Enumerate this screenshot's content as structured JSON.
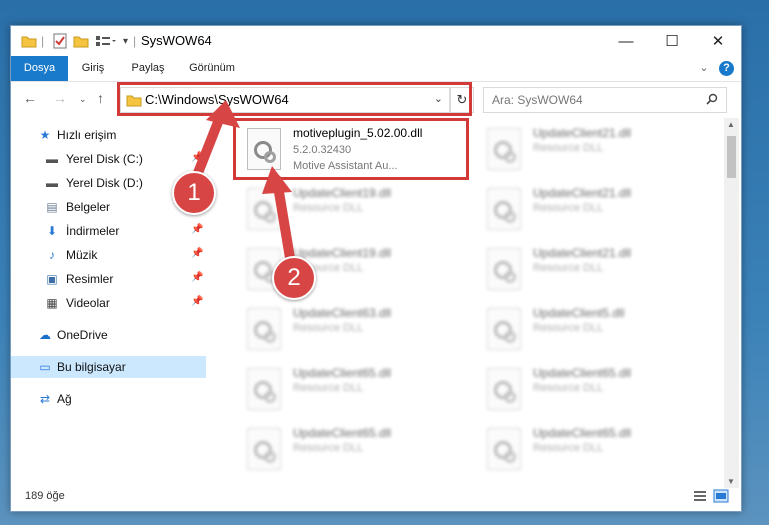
{
  "window": {
    "title": "SysWOW64",
    "controls": {
      "minimize": "—",
      "maximize": "☐",
      "close": "✕"
    }
  },
  "ribbon": {
    "tabs": [
      {
        "label": "Dosya",
        "active": true
      },
      {
        "label": "Giriş"
      },
      {
        "label": "Paylaş"
      },
      {
        "label": "Görünüm"
      }
    ],
    "help_label": "?"
  },
  "address": {
    "path": "C:\\Windows\\SysWOW64",
    "search_placeholder": "Ara: SysWOW64"
  },
  "sidebar": {
    "items": [
      {
        "label": "Hızlı erişim",
        "icon": "star-icon",
        "glyph": "★"
      },
      {
        "label": "Yerel Disk (C:)",
        "icon": "drive-icon",
        "glyph": "▬",
        "pinned": true
      },
      {
        "label": "Yerel Disk (D:)",
        "icon": "drive-icon",
        "glyph": "▬",
        "pinned": true
      },
      {
        "label": "Belgeler",
        "icon": "documents-icon",
        "glyph": "▤",
        "pinned": true
      },
      {
        "label": "İndirmeler",
        "icon": "download-icon",
        "glyph": "⬇",
        "pinned": true
      },
      {
        "label": "Müzik",
        "icon": "music-icon",
        "glyph": "♪",
        "pinned": true
      },
      {
        "label": "Resimler",
        "icon": "pictures-icon",
        "glyph": "▣",
        "pinned": true
      },
      {
        "label": "Videolar",
        "icon": "video-icon",
        "glyph": "▦",
        "pinned": true
      },
      {
        "label": "OneDrive",
        "icon": "cloud-icon",
        "glyph": "☁"
      },
      {
        "label": "Bu bilgisayar",
        "icon": "computer-icon",
        "glyph": "▭",
        "selected": true
      },
      {
        "label": "Ağ",
        "icon": "network-icon",
        "glyph": "⇄"
      }
    ]
  },
  "files": {
    "highlighted": {
      "name": "motiveplugin_5.02.00.dll",
      "version": "5.2.0.32430",
      "description": "Motive Assistant Au..."
    },
    "left_column": [
      {
        "name": "UpdateClient19.dll",
        "type": "Resource DLL"
      },
      {
        "name": "UpdateClient19.dll",
        "type": "Resource DLL"
      },
      {
        "name": "UpdateClient63.dll",
        "type": "Resource DLL"
      },
      {
        "name": "UpdateClient65.dll",
        "type": "Resource DLL"
      },
      {
        "name": "UpdateClient65.dll",
        "type": "Resource DLL"
      }
    ],
    "right_column": [
      {
        "name": "UpdateClient21.dll",
        "type": "Resource DLL"
      },
      {
        "name": "UpdateClient21.dll",
        "type": "Resource DLL"
      },
      {
        "name": "UpdateClient21.dll",
        "type": "Resource DLL"
      },
      {
        "name": "UpdateClient5.dll",
        "type": "Resource DLL"
      },
      {
        "name": "UpdateClient65.dll",
        "type": "Resource DLL"
      },
      {
        "name": "UpdateClient65.dll",
        "type": "Resource DLL"
      }
    ]
  },
  "status": {
    "item_count": "189 öğe"
  },
  "annotations": {
    "badge1": "1",
    "badge2": "2",
    "highlight_color": "#d23a3a"
  }
}
